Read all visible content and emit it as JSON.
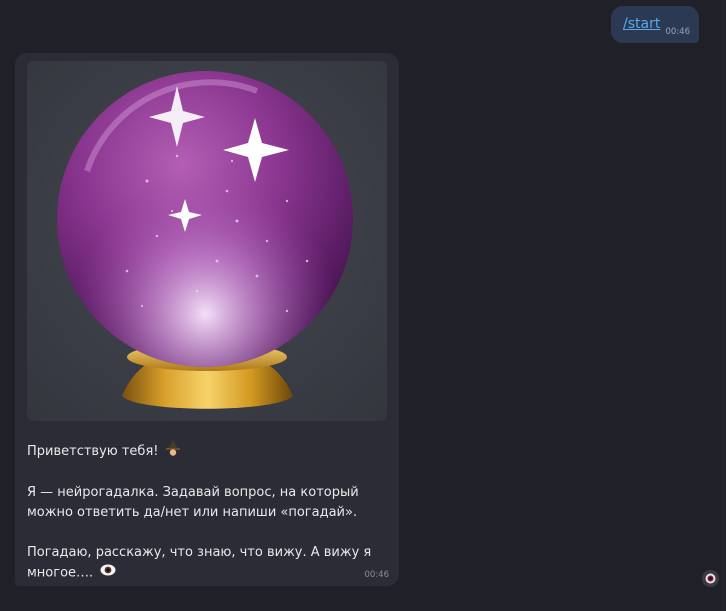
{
  "outgoing": {
    "command": "/start",
    "time": "00:46"
  },
  "incoming": {
    "image_alt": "crystal ball",
    "greeting": "Приветствую тебя!",
    "greeting_emoji": "witch",
    "line2a": "Я — нейрогадалка. Задавай вопрос, на который",
    "line2b": "можно ответить да/нет или напиши «погадай».",
    "line3a": "Погадаю, расскажу, что знаю, что вижу. А вижу я",
    "line3b": "многое….",
    "line3_emoji": "eye",
    "time": "00:46"
  },
  "colors": {
    "background": "#1f2028",
    "outgoing_bubble": "#2b3a52",
    "incoming_bubble": "#2b2c35",
    "link": "#5aa7ee",
    "orb": "#8e3c93",
    "stand": "#d9a12a"
  }
}
